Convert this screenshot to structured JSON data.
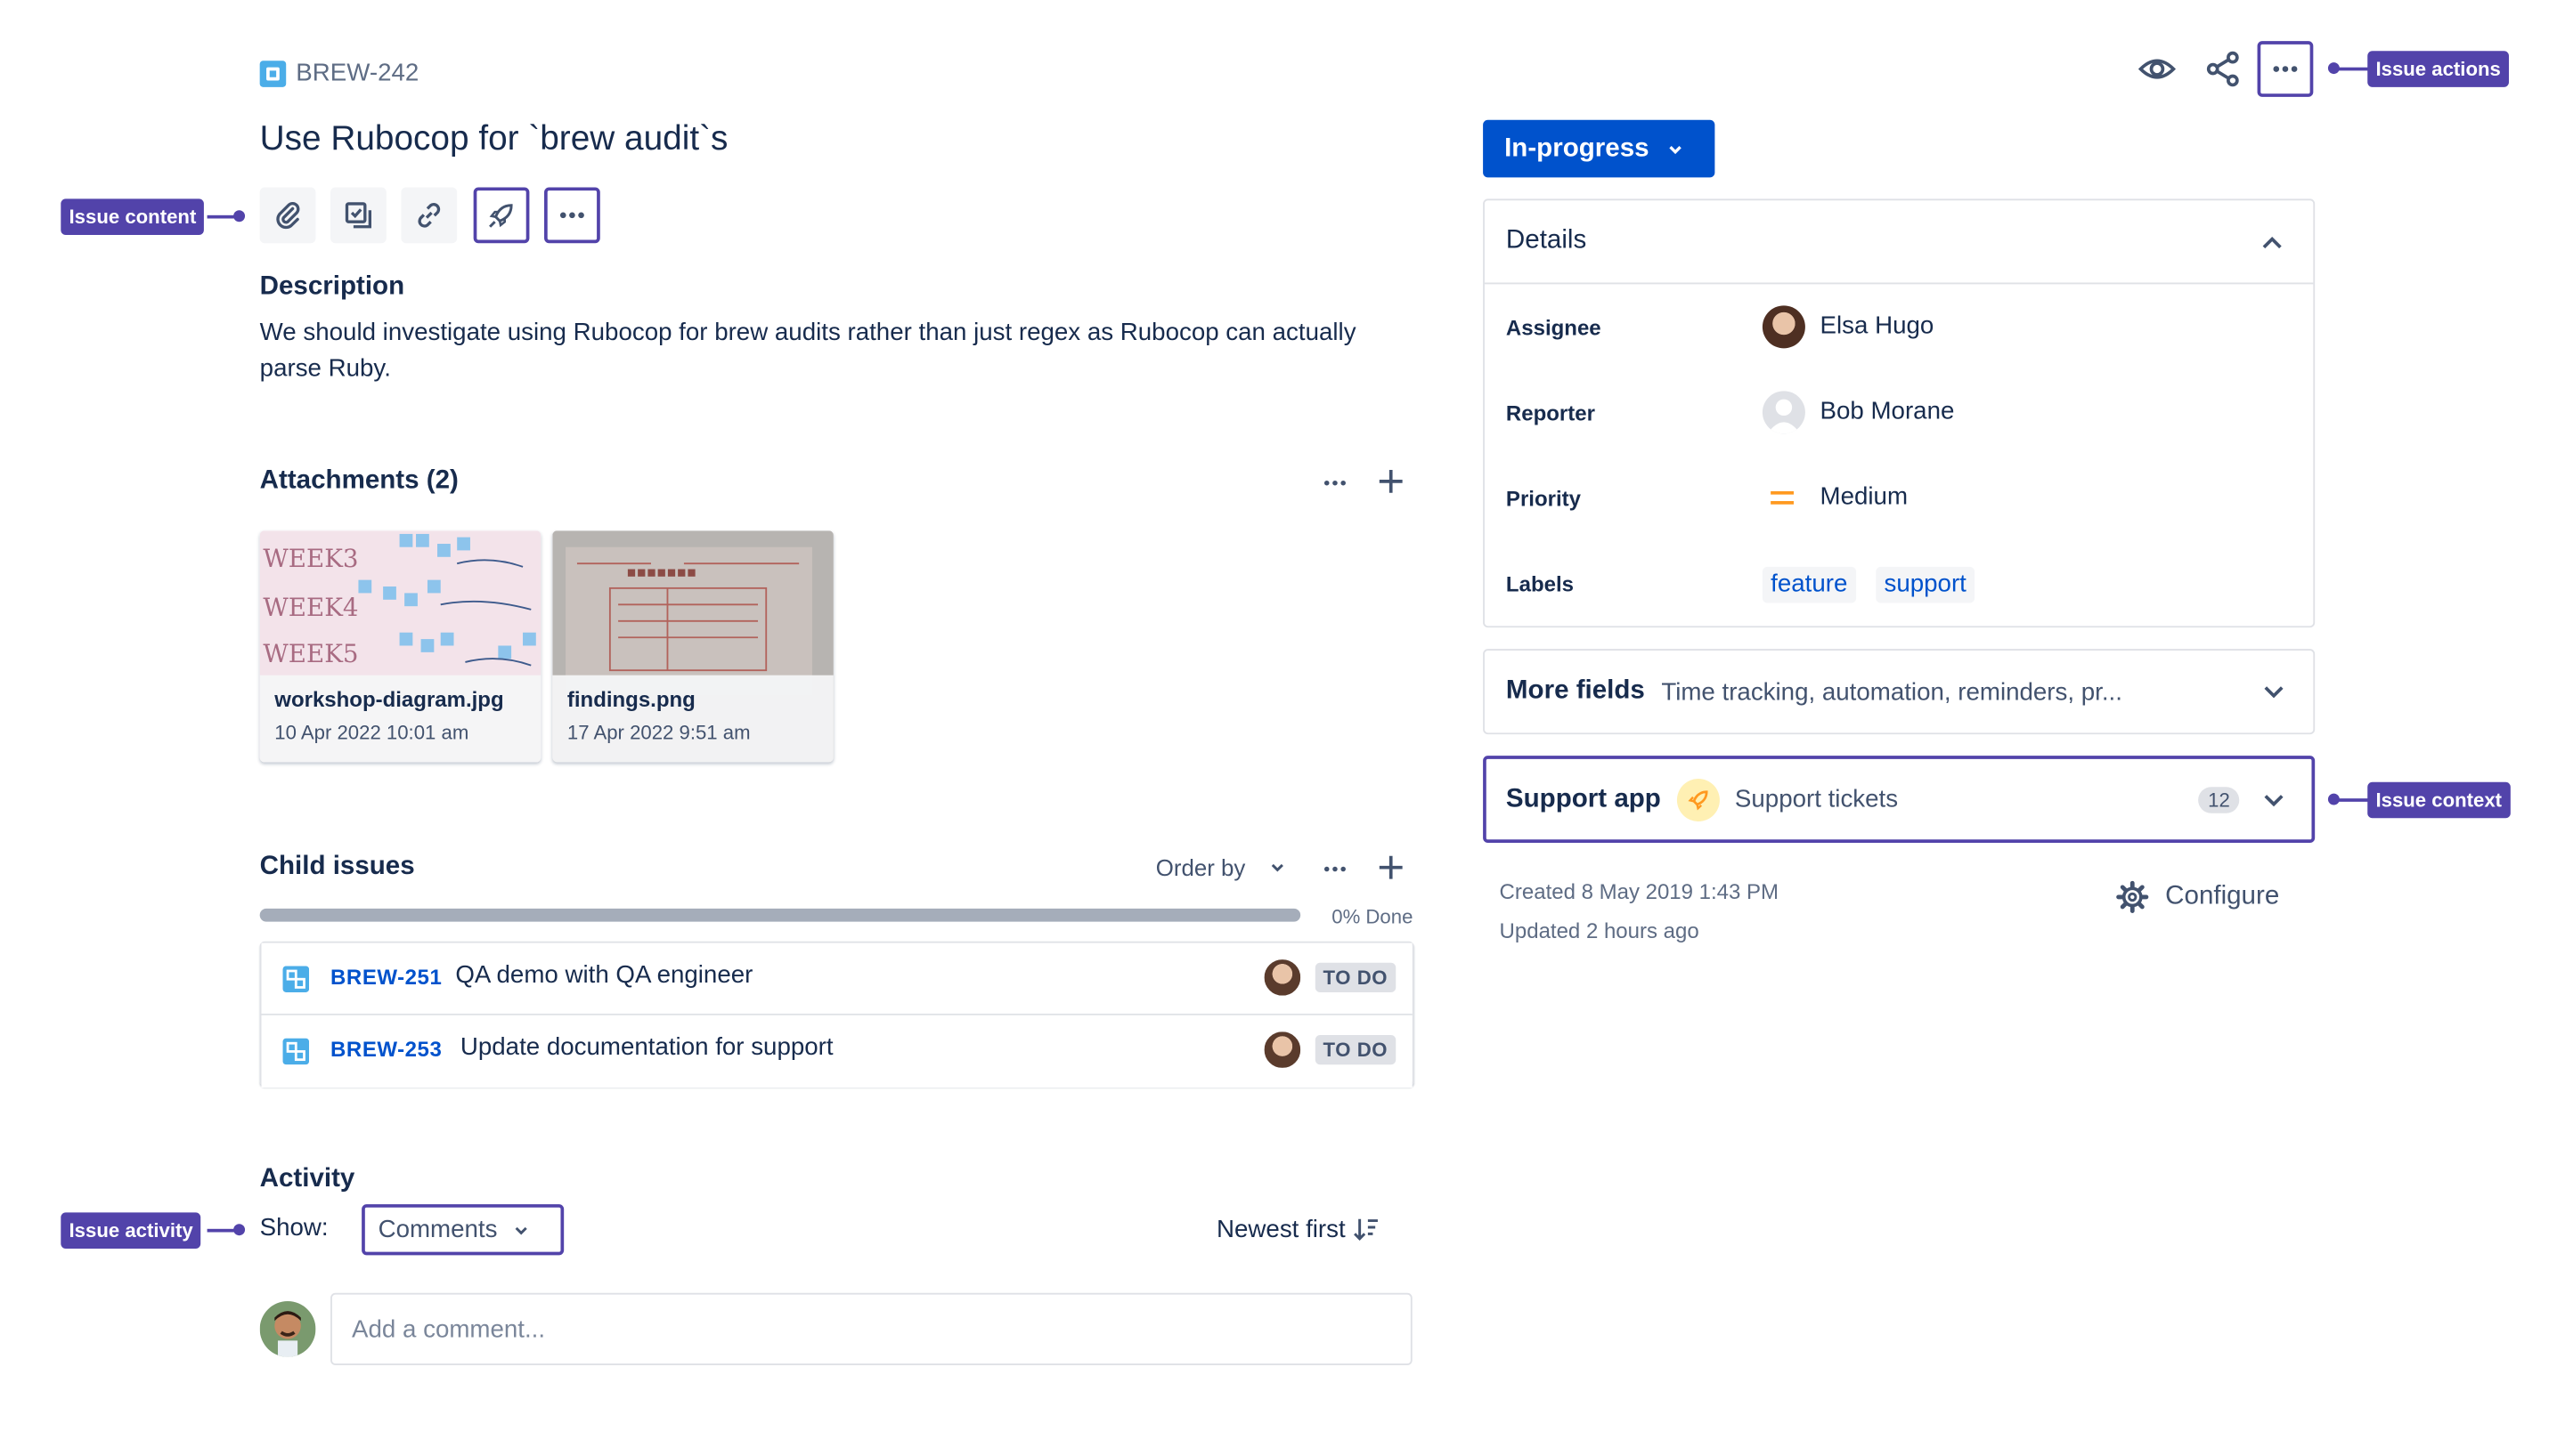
{
  "issue": {
    "key": "BREW-242",
    "title": "Use Rubocop for `brew audit`s",
    "description_heading": "Description",
    "description": "We should investigate using Rubocop for brew audits rather than just regex as Rubocop can actually parse Ruby."
  },
  "callouts": {
    "issue_content": "Issue content",
    "issue_actions": "Issue actions",
    "issue_context": "Issue context",
    "issue_activity": "Issue activity"
  },
  "attachments": {
    "title": "Attachments (2)",
    "items": [
      {
        "name": "workshop-diagram.jpg",
        "date": "10 Apr 2022 10:01 am"
      },
      {
        "name": "findings.png",
        "date": "17 Apr 2022 9:51 am"
      }
    ]
  },
  "child_issues": {
    "title": "Child issues",
    "order_by": "Order by",
    "progress_label": "0% Done",
    "progress": 0,
    "items": [
      {
        "key": "BREW-251",
        "summary": "QA demo with QA engineer",
        "status": "TO DO"
      },
      {
        "key": "BREW-253",
        "summary": "Update documentation for support",
        "status": "TO DO"
      }
    ]
  },
  "activity": {
    "title": "Activity",
    "show_label": "Show:",
    "filter": "Comments",
    "sort": "Newest first",
    "comment_placeholder": "Add a comment..."
  },
  "status": {
    "label": "In-progress",
    "color": "#0052cc"
  },
  "details": {
    "title": "Details",
    "assignee_label": "Assignee",
    "assignee": "Elsa Hugo",
    "reporter_label": "Reporter",
    "reporter": "Bob Morane",
    "priority_label": "Priority",
    "priority": "Medium",
    "labels_label": "Labels",
    "labels": [
      "feature",
      "support"
    ]
  },
  "more_fields": {
    "title": "More fields",
    "summary": "Time tracking, automation, reminders, pr..."
  },
  "support_app": {
    "title": "Support app",
    "link": "Support tickets",
    "count": "12"
  },
  "footer": {
    "created": "Created 8 May 2019 1:43 PM",
    "updated": "Updated 2 hours ago",
    "configure": "Configure"
  },
  "colors": {
    "accent": "#5243aa",
    "link": "#0052cc",
    "priority": "#ff991f"
  }
}
